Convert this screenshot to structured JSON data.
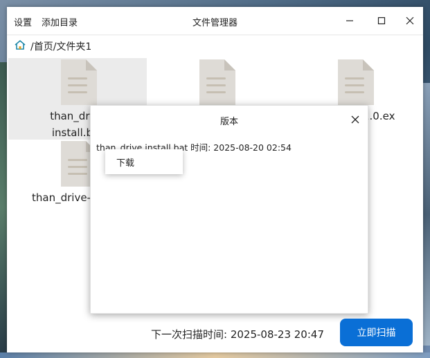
{
  "menu": {
    "settings_label": "设置",
    "add_dir_label": "添加目录"
  },
  "window": {
    "title": "文件管理器"
  },
  "path": {
    "text": "/首页/文件夹1"
  },
  "files": [
    {
      "line1": "than_drive",
      "line2": "install.bat"
    },
    {
      "line1": "",
      "line2": ""
    },
    {
      "line1": "1.0.ex",
      "line2": ""
    },
    {
      "line1": "than_drive-",
      "line2": ""
    }
  ],
  "dialog": {
    "title": "版本",
    "version_text": "than_drive install.bat 时间: 2025-08-20 02:54"
  },
  "context_menu": {
    "download_label": "下载"
  },
  "footer": {
    "next_scan_text": "下一次扫描时间: 2025-08-23 20:47",
    "scan_button_label": "立即扫描"
  },
  "colors": {
    "accent": "#0a6fd6",
    "selected_bg": "#ebebeb",
    "home_icon": "#1e88a8"
  }
}
